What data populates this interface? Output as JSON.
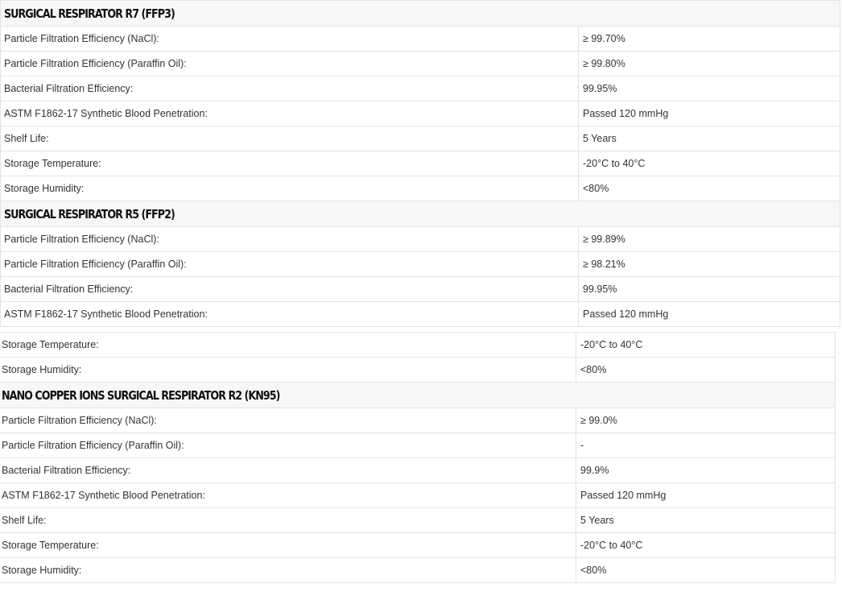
{
  "sections": [
    {
      "title": "SURGICAL RESPIRATOR R7 (FFP3)",
      "rows": [
        {
          "label": "Particle Filtration Efficiency (NaCl):",
          "value": "≥ 99.70%"
        },
        {
          "label": "Particle Filtration Efficiency (Paraffin Oil):",
          "value": "≥ 99.80%"
        },
        {
          "label": "Bacterial Filtration Efficiency:",
          "value": "99.95%"
        },
        {
          "label": "ASTM F1862-17 Synthetic Blood Penetration:",
          "value": "Passed 120 mmHg"
        },
        {
          "label": "Shelf Life:",
          "value": "5 Years"
        },
        {
          "label": "Storage Temperature:",
          "value": "-20°C to 40°C"
        },
        {
          "label": "Storage Humidity:",
          "value": "<80%"
        }
      ]
    },
    {
      "title": "SURGICAL RESPIRATOR R5 (FFP2)",
      "rows": [
        {
          "label": "Particle Filtration Efficiency (NaCl):",
          "value": "≥ 99.89%"
        },
        {
          "label": "Particle Filtration Efficiency (Paraffin Oil):",
          "value": "≥ 98.21%"
        },
        {
          "label": "Bacterial Filtration Efficiency:",
          "value": "99.95%"
        },
        {
          "label": "ASTM F1862-17 Synthetic Blood Penetration:",
          "value": "Passed 120 mmHg"
        }
      ]
    },
    {
      "rows": [
        {
          "label": "Storage Temperature:",
          "value": "-20°C to 40°C"
        },
        {
          "label": "Storage Humidity:",
          "value": "<80%"
        }
      ]
    },
    {
      "title": "NANO COPPER IONS SURGICAL RESPIRATOR R2 (KN95)",
      "rows": [
        {
          "label": "Particle Filtration Efficiency (NaCl):",
          "value": "≥ 99.0%"
        },
        {
          "label": "Particle Filtration Efficiency (Paraffin Oil):",
          "value": "-"
        },
        {
          "label": "Bacterial Filtration Efficiency:",
          "value": "99.9%"
        },
        {
          "label": "ASTM F1862-17 Synthetic Blood Penetration:",
          "value": "Passed 120 mmHg"
        },
        {
          "label": "Shelf Life:",
          "value": "5 Years"
        },
        {
          "label": "Storage Temperature:",
          "value": "-20°C to 40°C"
        },
        {
          "label": "Storage Humidity:",
          "value": "<80%"
        }
      ]
    }
  ]
}
